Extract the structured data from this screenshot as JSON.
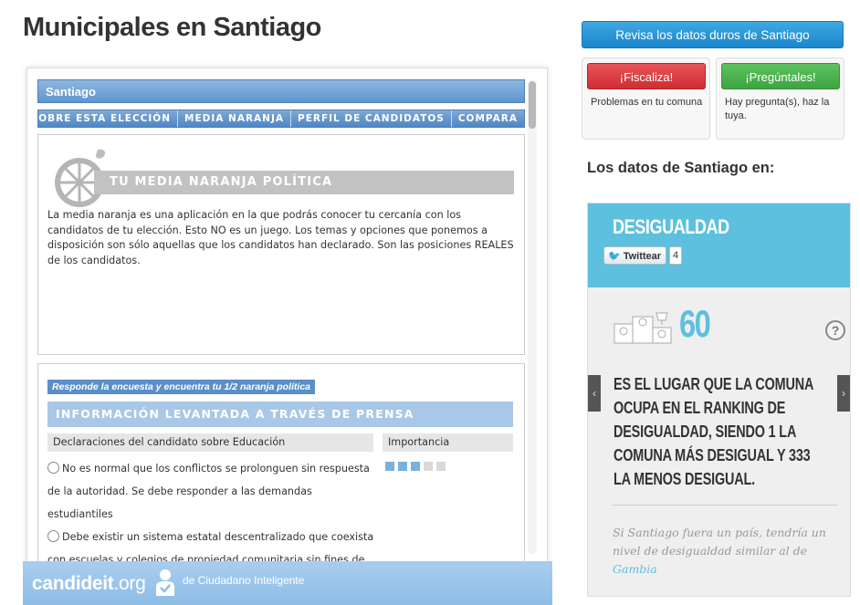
{
  "page": {
    "title": "Municipales en Santiago"
  },
  "embed": {
    "city": "Santiago",
    "nav": [
      "SOBRE ESTA ELECCIÓN",
      "MEDIA NARANJA",
      "PERFIL DE CANDIDATOS",
      "COMPARA"
    ],
    "media_naranja": {
      "title": "TU MEDIA NARANJA POLÍTICA",
      "description": "La media naranja es una aplicación en la que podrás conocer tu cercanía con los candidatos de tu elección. Esto NO es un juego. Los temas y opciones que ponemos a disposición son sólo aquellas que los candidatos han declarado. Son las posiciones REALES de los candidatos."
    },
    "survey": {
      "tag": "Responde la encuesta y encuentra tu 1/2 naranja política",
      "banner": "INFORMACIÓN LEVANTADA A TRAVÉS DE PRENSA",
      "col_statements": "Declaraciones del candidato sobre Educación",
      "col_importance": "Importancia",
      "importance_level": 3,
      "importance_max": 5,
      "answers": [
        {
          "line1": "No es normal que los conflictos se prolonguen sin respuesta",
          "line2": "de la autoridad. Se debe responder a las demandas estudiantiles"
        },
        {
          "line1": "Debe existir un sistema estatal descentralizado que coexista",
          "line2": "con escuelas y colegios de propiedad comunitaria sin fines de"
        }
      ]
    },
    "footer": {
      "logo_main": "candideit",
      "logo_suffix": ".org",
      "by": "de Ciudadano Inteligente"
    }
  },
  "sidebar": {
    "main_button": "Revisa los datos duros de Santiago",
    "fiscaliza": {
      "button": "¡Fiscaliza!",
      "text": "Problemas en tu comuna"
    },
    "preguntales": {
      "button": "¡Pregúntales!",
      "text": "Hay pregunta(s), haz la tuya."
    },
    "heading": "Los datos de Santiago en:",
    "panel": {
      "title": "DESIGUALDAD",
      "tweet_label": "Twittear",
      "tweet_count": "4",
      "rank": "60",
      "help": "?",
      "description": "ES EL LUGAR QUE LA COMUNA OCUPA EN EL RANKING DE DESIGUALDAD, SIENDO 1 LA COMUNA MÁS DESIGUAL Y 333 LA MENOS DESIGUAL.",
      "comparison_text": "Si Santiago fuera un país, tendría un nivel de desigualdad similar al de",
      "comparison_country": "Gambia",
      "arrow_left": "‹",
      "arrow_right": "›"
    }
  },
  "colors": {
    "accent_blue": "#5cc0de",
    "nav_blue": "#4f86c5",
    "red": "#cf2d33",
    "green": "#3ea342"
  }
}
